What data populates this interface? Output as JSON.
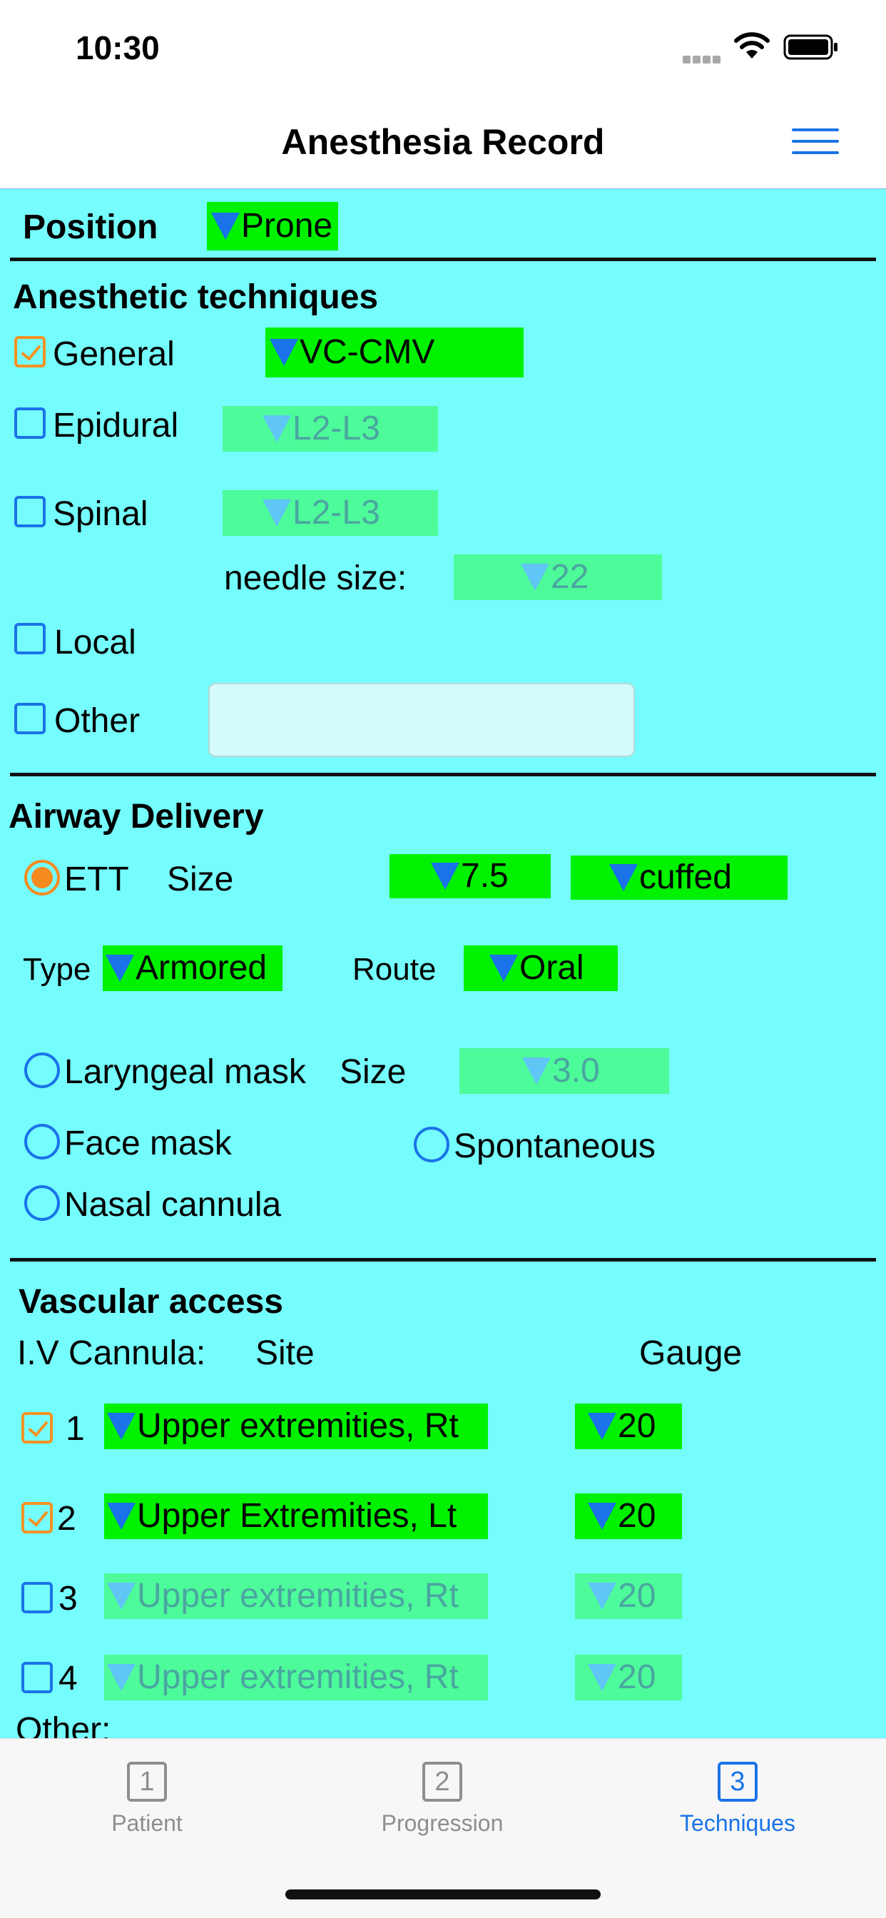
{
  "status_bar": {
    "time": "10:30"
  },
  "header": {
    "title": "Anesthesia Record"
  },
  "position": {
    "label": "Position",
    "value": "Prone"
  },
  "anesthetic": {
    "heading": "Anesthetic techniques",
    "general": {
      "label": "General",
      "checked": true,
      "value": "VC-CMV"
    },
    "epidural": {
      "label": "Epidural",
      "checked": false,
      "value": "L2-L3"
    },
    "spinal": {
      "label": "Spinal",
      "checked": false,
      "value": "L2-L3"
    },
    "needle_label": "needle size:",
    "needle_value": "22",
    "local": {
      "label": "Local",
      "checked": false
    },
    "other": {
      "label": "Other",
      "checked": false,
      "value": ""
    }
  },
  "airway": {
    "heading": "Airway Delivery",
    "ett_label": "ETT",
    "size_label": "Size",
    "ett_size": "7.5",
    "cuff": "cuffed",
    "type_label": "Type",
    "type_value": "Armored",
    "route_label": "Route",
    "route_value": "Oral",
    "lma_label": "Laryngeal mask",
    "lma_size_label": "Size",
    "lma_size": "3.0",
    "face_mask": "Face mask",
    "spontaneous": "Spontaneous",
    "nasal": "Nasal cannula"
  },
  "vascular": {
    "heading": "Vascular access",
    "iv_label": "I.V Cannula:",
    "site_label": "Site",
    "gauge_label": "Gauge",
    "rows": [
      {
        "num": "1",
        "checked": true,
        "site": "Upper extremities, Rt",
        "gauge": "20"
      },
      {
        "num": "2",
        "checked": true,
        "site": "Upper Extremities, Lt",
        "gauge": "20"
      },
      {
        "num": "3",
        "checked": false,
        "site": "Upper extremities, Rt",
        "gauge": "20"
      },
      {
        "num": "4",
        "checked": false,
        "site": "Upper extremities, Rt",
        "gauge": "20"
      }
    ],
    "other_label": "Other:"
  },
  "tabs": [
    {
      "num": "1",
      "label": "Patient"
    },
    {
      "num": "2",
      "label": "Progression"
    },
    {
      "num": "3",
      "label": "Techniques"
    }
  ],
  "colors": {
    "background": "#75fcfd",
    "dropdown_active": "#00f200",
    "dropdown_inactive": "#4dfb9a",
    "accent": "#1a73e8",
    "checked": "#f59222"
  }
}
